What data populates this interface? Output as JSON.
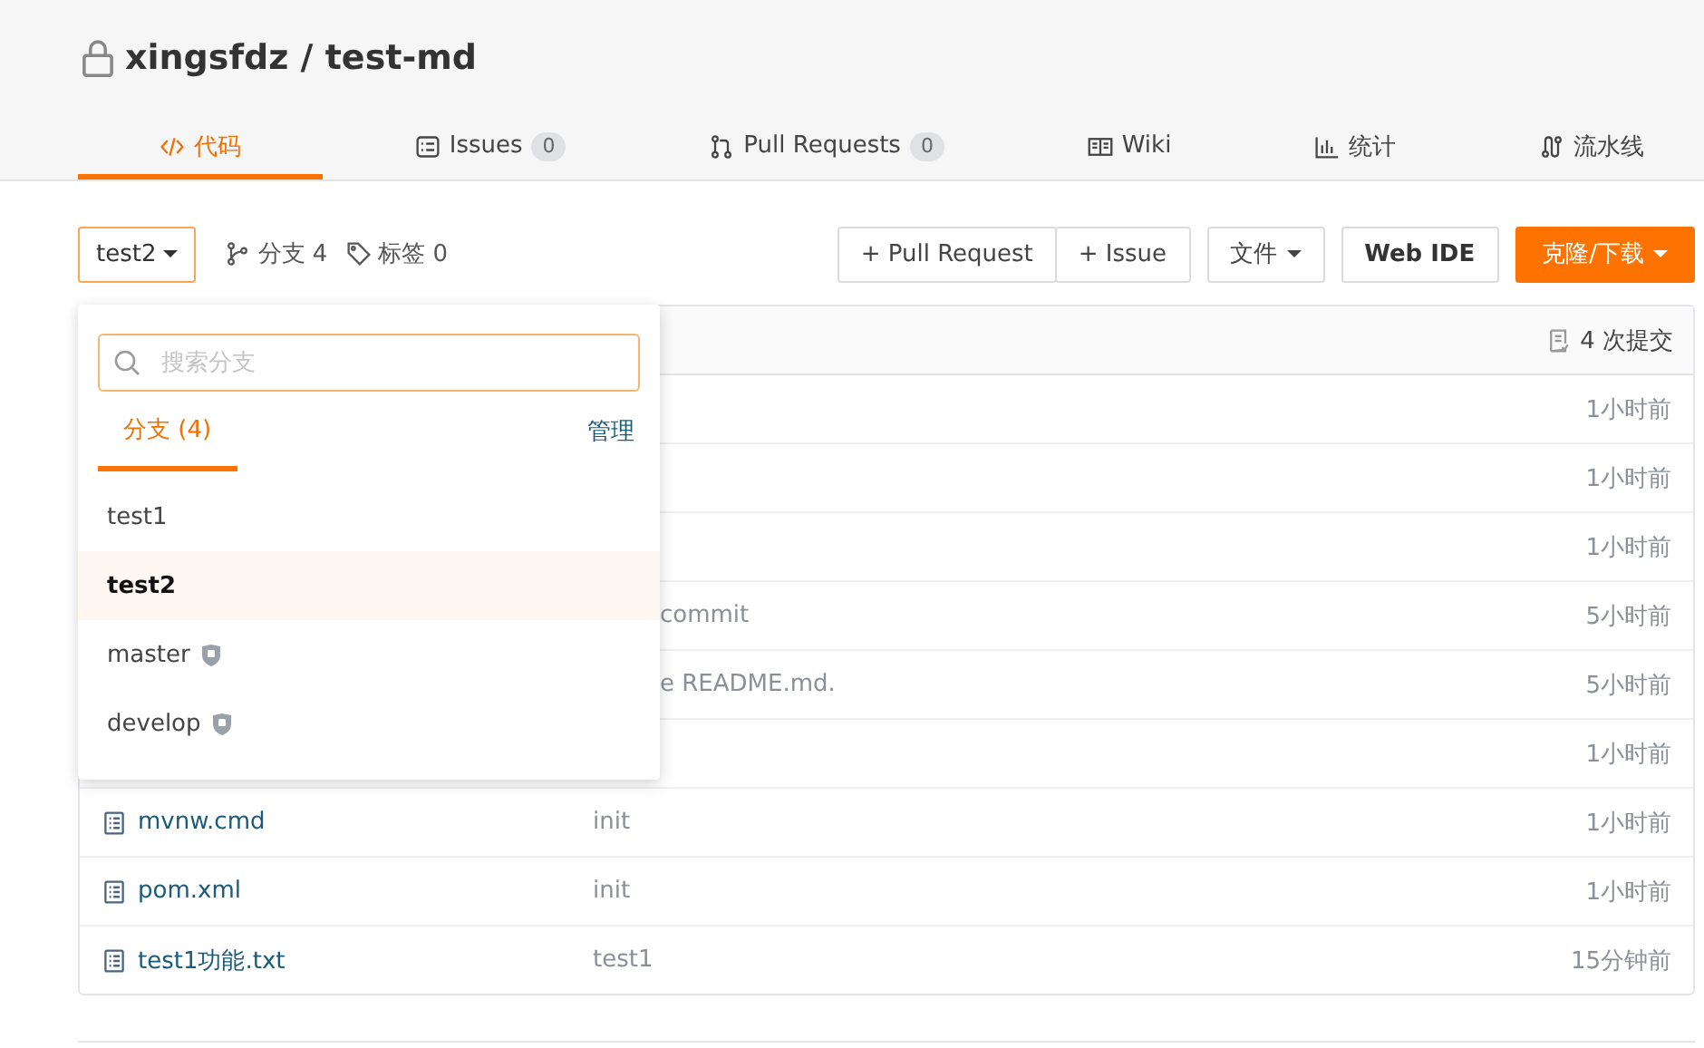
{
  "repo": {
    "owner": "xingsfdz",
    "separator": "/",
    "name": "test-md"
  },
  "tabs": [
    {
      "label": "代码",
      "kind": "code",
      "selected": true
    },
    {
      "label": "Issues",
      "kind": "issues",
      "count": "0",
      "selected": false
    },
    {
      "label": "Pull Requests",
      "kind": "pr",
      "count": "0",
      "selected": false
    },
    {
      "label": "Wiki",
      "kind": "book",
      "selected": false
    },
    {
      "label": "统计",
      "kind": "chart",
      "selected": false
    },
    {
      "label": "流水线",
      "kind": "pipeline",
      "selected": false
    }
  ],
  "toolbar": {
    "branch": "test2",
    "branches": "分支 4",
    "tags": "标签 0",
    "buttons": [
      {
        "label": "+ Pull Request",
        "kind": "group"
      },
      {
        "label": "+ Issue",
        "kind": "group"
      },
      {
        "label": "文件",
        "kind": "menu"
      },
      {
        "label": "Web IDE",
        "kind": "bold"
      },
      {
        "label": "克隆/下载",
        "kind": "primary"
      }
    ]
  },
  "files": {
    "commits": "4 次提交",
    "rows": [
      {
        "time": "1小时前"
      },
      {
        "time": "1小时前"
      },
      {
        "time": "1小时前"
      },
      {
        "message": "commit",
        "time": "5小时前"
      },
      {
        "message": "e README.md.",
        "time": "5小时前"
      },
      {
        "time": "1小时前"
      },
      {
        "name": "mvnw.cmd",
        "message": "init",
        "time": "1小时前"
      },
      {
        "name": "pom.xml",
        "message": "init",
        "time": "1小时前"
      },
      {
        "name": "test1功能.txt",
        "message": "test1",
        "time": "15分钟前"
      }
    ]
  },
  "branch_menu": {
    "placeholder": "搜索分支",
    "tab": "分支 (4)",
    "manage": "管理",
    "items": [
      {
        "name": "test1",
        "selected": false,
        "protected": false
      },
      {
        "name": "test2",
        "selected": true,
        "protected": false
      },
      {
        "name": "master",
        "selected": false,
        "protected": true
      },
      {
        "name": "develop",
        "selected": false,
        "protected": true
      }
    ]
  }
}
